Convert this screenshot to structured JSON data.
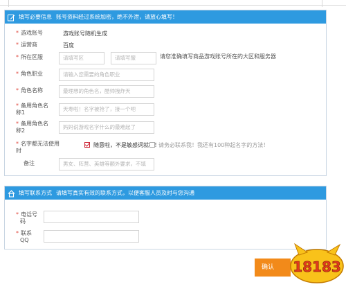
{
  "required_panel": {
    "title": "填写必要信息",
    "subtitle": "账号资料经过系统加密，绝不外泄，请放心填写！",
    "fields": {
      "account": {
        "label": "游戏账号",
        "value": "游戏账号随机生成"
      },
      "operator": {
        "label": "运营商",
        "value": "百度"
      },
      "region": {
        "label": "所在区服",
        "placeholder_area": "请填写区",
        "placeholder_server": "请填写服",
        "hint": "请您准确填写商品游戏账号所在的大区和服务器"
      },
      "profession": {
        "label": "角色职业",
        "placeholder": "请输入您需要的角色职业"
      },
      "role_name": {
        "label": "角色名称",
        "placeholder": "最理想的角色名，酷帅拽炸天"
      },
      "backup1": {
        "label_line1": "备用角色名",
        "label_line2": "称1",
        "placeholder": "天寿啦！名字被抢了，接一个吧"
      },
      "backup2": {
        "label_line1": "备用角色名",
        "label_line2": "称2",
        "placeholder": "妈妈说游戏名字什么的最难起了"
      },
      "name_fallback": {
        "label_line1": "名字都无法使用",
        "label_line2": "时",
        "option1": "随意啦，不是敏感词就行！",
        "option2": "请务必联系我！我还有100种起名字的方法！"
      },
      "remark": {
        "label": "备注",
        "placeholder": "男女、阵营、英雄等额外要求，不填"
      }
    }
  },
  "contact_panel": {
    "title": "填写联系方式",
    "subtitle": "请填写真实有效的联系方式，以便客服人员及时与您沟通",
    "fields": {
      "phone": {
        "label_line1": "电话号",
        "label_line2": "码"
      },
      "qq": {
        "label_line1": "联系",
        "label_line2": "QQ"
      }
    }
  },
  "confirm_label": "确认",
  "watermark": "18183",
  "colors": {
    "accent": "#2e9ae0",
    "required": "#e0463b",
    "confirm": "#f28a1a"
  }
}
